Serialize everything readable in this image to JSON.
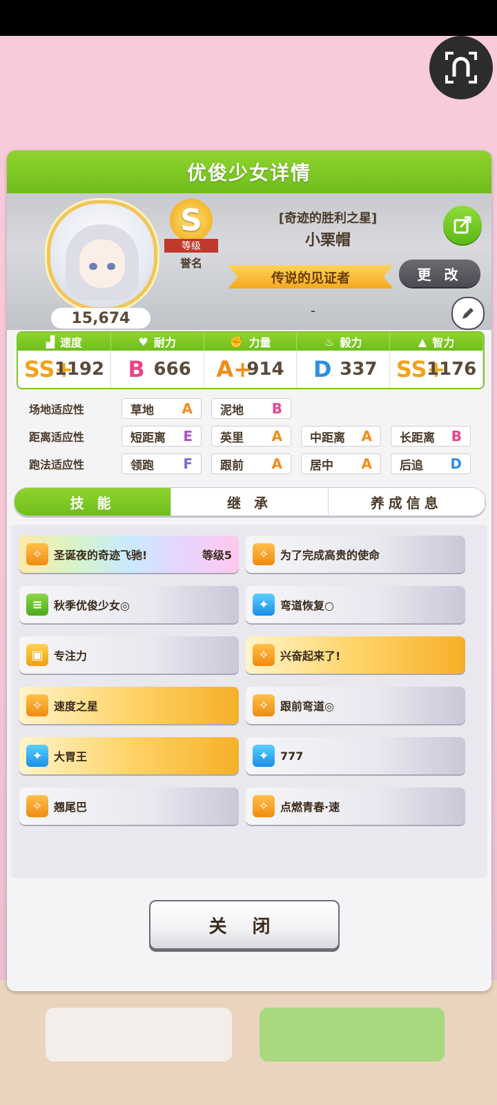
{
  "dialog": {
    "title": "优俊少女详情"
  },
  "profile": {
    "epithet": "[奇迹的胜利之星]",
    "name": "小栗帽",
    "score": "15,674",
    "rank_letter": "S",
    "rank_ribbon": "等级",
    "rank_label": "誉名",
    "title": "传说的见证者",
    "change_label": "更 改",
    "subtitle": "-"
  },
  "stats": [
    {
      "label": "速度",
      "grade": "SS+",
      "value": "1192",
      "color": "#f0a419"
    },
    {
      "label": "耐力",
      "grade": "B",
      "value": "666",
      "color": "#e8458c"
    },
    {
      "label": "力量",
      "grade": "A+",
      "value": "914",
      "color": "#f08c1a"
    },
    {
      "label": "毅力",
      "grade": "D",
      "value": "337",
      "color": "#2f8fe0"
    },
    {
      "label": "智力",
      "grade": "SS+",
      "value": "1176",
      "color": "#f0a419"
    }
  ],
  "aptitude": {
    "rows": [
      {
        "label": "场地适应性",
        "items": [
          {
            "name": "草地",
            "grade": "A"
          },
          {
            "name": "泥地",
            "grade": "B"
          }
        ]
      },
      {
        "label": "距离适应性",
        "items": [
          {
            "name": "短距离",
            "grade": "E"
          },
          {
            "name": "英里",
            "grade": "A"
          },
          {
            "name": "中距离",
            "grade": "A"
          },
          {
            "name": "长距离",
            "grade": "B"
          }
        ]
      },
      {
        "label": "跑法适应性",
        "items": [
          {
            "name": "领跑",
            "grade": "F"
          },
          {
            "name": "跟前",
            "grade": "A"
          },
          {
            "name": "居中",
            "grade": "A"
          },
          {
            "name": "后追",
            "grade": "D"
          }
        ]
      }
    ],
    "grade_colors": {
      "A": "#f08c1a",
      "B": "#e8458c",
      "D": "#2f8fe0",
      "E": "#b04fd0",
      "F": "#7a6ad0"
    }
  },
  "tabs": [
    "技 能",
    "继 承",
    "养成信息"
  ],
  "skills": [
    {
      "name": "圣诞夜的奇迹飞驰!",
      "level": "等级5",
      "style": "rainbow",
      "icon": "speed-icon"
    },
    {
      "name": "为了完成高贵的使命",
      "level": "",
      "style": "plain",
      "icon": "speed-icon"
    },
    {
      "name": "秋季优俊少女◎",
      "level": "",
      "style": "plain",
      "icon": "green-skill-icon"
    },
    {
      "name": "弯道恢复○",
      "level": "",
      "style": "plain",
      "icon": "recovery-icon"
    },
    {
      "name": "专注力",
      "level": "",
      "style": "plain",
      "icon": "gate-icon"
    },
    {
      "name": "兴奋起来了!",
      "level": "",
      "style": "gold",
      "icon": "speed-icon"
    },
    {
      "name": "速度之星",
      "level": "",
      "style": "gold",
      "icon": "speed-icon"
    },
    {
      "name": "跟前弯道◎",
      "level": "",
      "style": "plain",
      "icon": "speed-icon"
    },
    {
      "name": "大胃王",
      "level": "",
      "style": "gold",
      "icon": "recovery-icon"
    },
    {
      "name": "777",
      "level": "",
      "style": "plain",
      "icon": "recovery-icon"
    },
    {
      "name": "翘尾巴",
      "level": "",
      "style": "plain",
      "icon": "speed-icon"
    },
    {
      "name": "点燃青春·速",
      "level": "",
      "style": "plain",
      "icon": "speed-icon"
    }
  ],
  "close_label": "关 闭"
}
